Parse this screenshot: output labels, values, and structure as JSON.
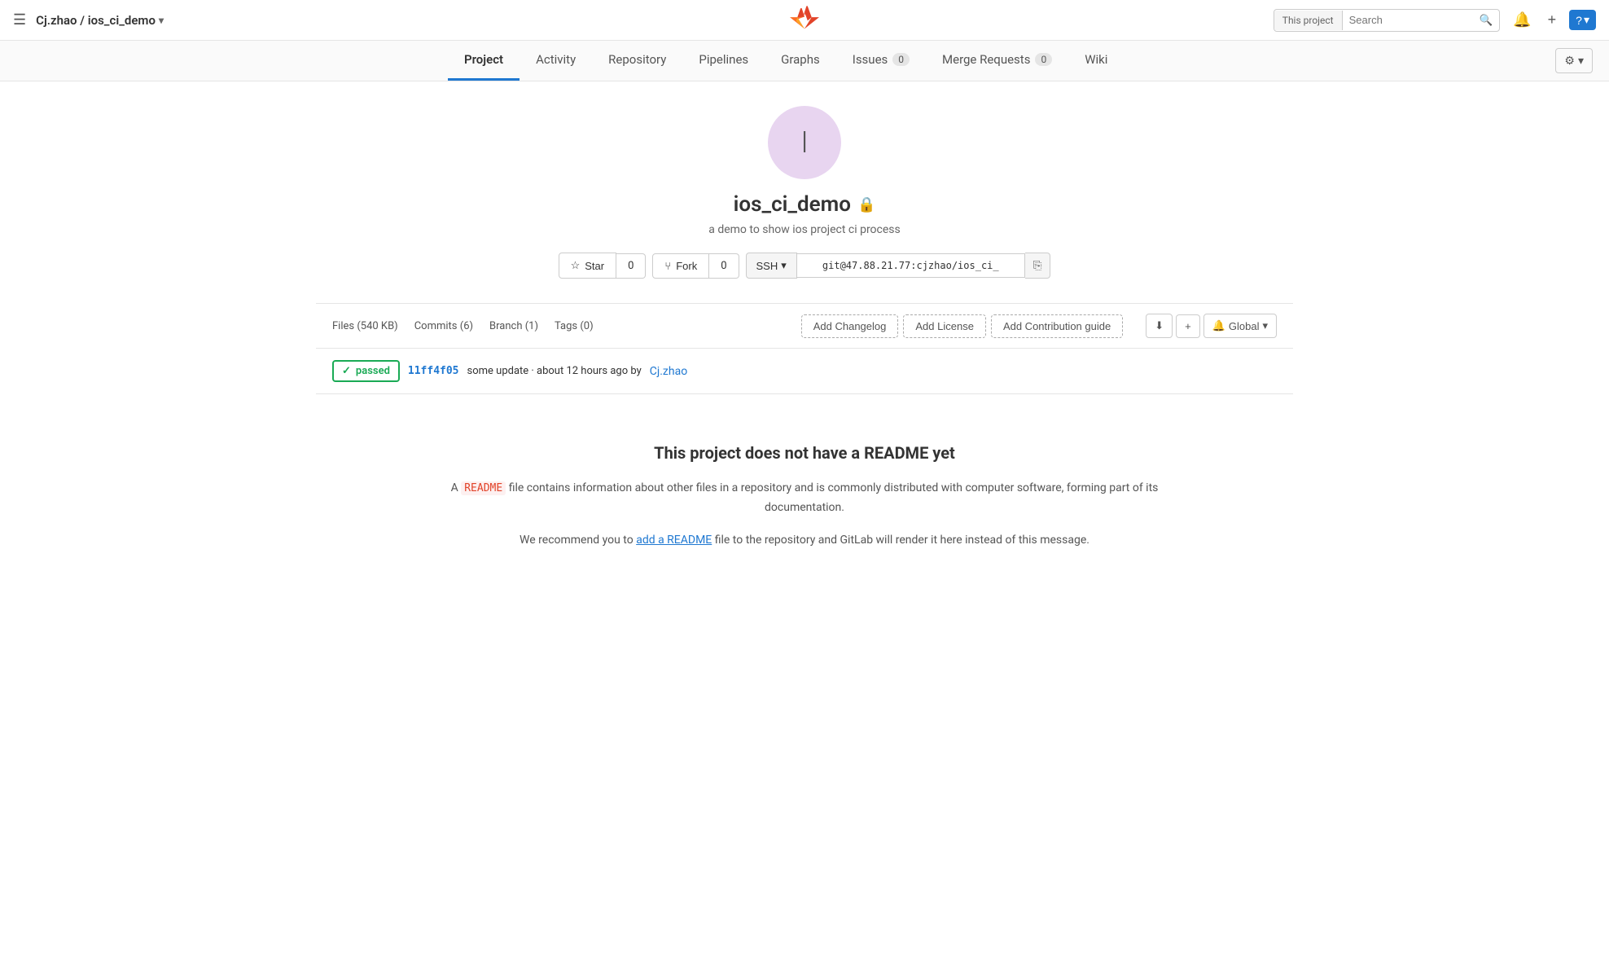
{
  "topnav": {
    "hamburger": "☰",
    "brand": "Cj.zhao / ios_ci_demo",
    "brand_chevron": "▾",
    "search_project_label": "This project",
    "search_placeholder": "Search",
    "bell_icon": "🔔",
    "plus_icon": "+",
    "help_icon": "?",
    "help_chevron": "▾"
  },
  "secondarynav": {
    "tabs": [
      {
        "id": "project",
        "label": "Project",
        "active": true,
        "badge": null
      },
      {
        "id": "activity",
        "label": "Activity",
        "active": false,
        "badge": null
      },
      {
        "id": "repository",
        "label": "Repository",
        "active": false,
        "badge": null
      },
      {
        "id": "pipelines",
        "label": "Pipelines",
        "active": false,
        "badge": null
      },
      {
        "id": "graphs",
        "label": "Graphs",
        "active": false,
        "badge": null
      },
      {
        "id": "issues",
        "label": "Issues",
        "active": false,
        "badge": "0"
      },
      {
        "id": "merge-requests",
        "label": "Merge Requests",
        "active": false,
        "badge": "0"
      },
      {
        "id": "wiki",
        "label": "Wiki",
        "active": false,
        "badge": null
      }
    ],
    "settings_icon": "⚙",
    "settings_chevron": "▾"
  },
  "project": {
    "avatar_letter": "I",
    "name": "ios_ci_demo",
    "lock_icon": "🔒",
    "description": "a demo to show ios project ci process",
    "star_label": "★ Star",
    "star_count": "0",
    "fork_label": "⑂ Fork",
    "fork_count": "0"
  },
  "clone": {
    "protocol": "SSH",
    "chevron": "▾",
    "url": "git@47.88.21.77:cjzhao/ios_ci_",
    "copy_icon": "⎘"
  },
  "filebar": {
    "files": "Files (540 KB)",
    "commits": "Commits (6)",
    "branch": "Branch (1)",
    "tags": "Tags (0)",
    "add_changelog": "Add Changelog",
    "add_license": "Add License",
    "add_contribution": "Add Contribution guide",
    "download_icon": "⬇",
    "plus_icon": "+",
    "bell_icon": "🔔",
    "notification_label": "Global",
    "notification_chevron": "▾"
  },
  "commit": {
    "status": "passed",
    "check_icon": "✓",
    "hash": "11ff4f05",
    "message": "some update · about 12 hours ago by",
    "author": "Cj.zhao"
  },
  "readme": {
    "title": "This project does not have a README yet",
    "desc_prefix": "A",
    "keyword": "README",
    "desc_suffix": "file contains information about other files in a repository and is commonly distributed with computer software, forming part of its documentation.",
    "recommendation_prefix": "We recommend you to",
    "recommendation_link": "add a README",
    "recommendation_suffix": "file to the repository and GitLab will render it here instead of this message."
  }
}
